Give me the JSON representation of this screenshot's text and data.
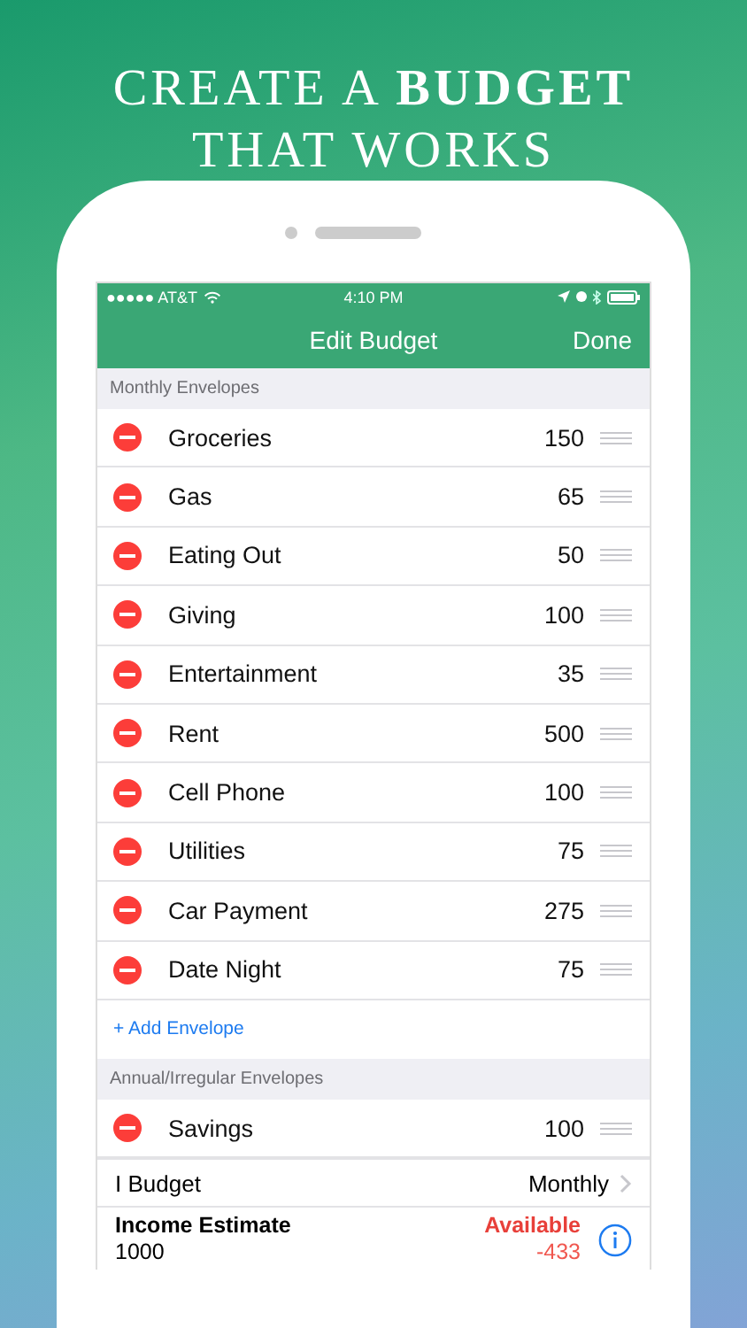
{
  "headline": [
    "CREATE A **BUDGET**",
    "THAT WORKS"
  ],
  "status_bar": {
    "carrier": "●●●●● AT&T",
    "time": "4:10 PM"
  },
  "nav": {
    "title": "Edit Budget",
    "done": "Done"
  },
  "sections": [
    {
      "title": "Monthly Envelopes",
      "envelopes": [
        {
          "name": "Groceries",
          "amount": "150"
        },
        {
          "name": "Gas",
          "amount": "65"
        },
        {
          "name": "Eating Out",
          "amount": "50"
        },
        {
          "name": "Giving",
          "amount": "100"
        },
        {
          "name": "Entertainment",
          "amount": "35"
        },
        {
          "name": "Rent",
          "amount": "500"
        },
        {
          "name": "Cell Phone",
          "amount": "100"
        },
        {
          "name": "Utilities",
          "amount": "75"
        },
        {
          "name": "Car Payment",
          "amount": "275"
        },
        {
          "name": "Date Night",
          "amount": "75"
        }
      ],
      "add_link": "+ Add Envelope"
    },
    {
      "title": "Annual/Irregular Envelopes",
      "envelopes": [
        {
          "name": "Savings",
          "amount": "100"
        }
      ]
    }
  ],
  "budget_period": {
    "label": "I Budget",
    "value": "Monthly"
  },
  "income": {
    "label": "Income Estimate",
    "value": "1000",
    "available_label": "Available",
    "available_value": "-433"
  }
}
